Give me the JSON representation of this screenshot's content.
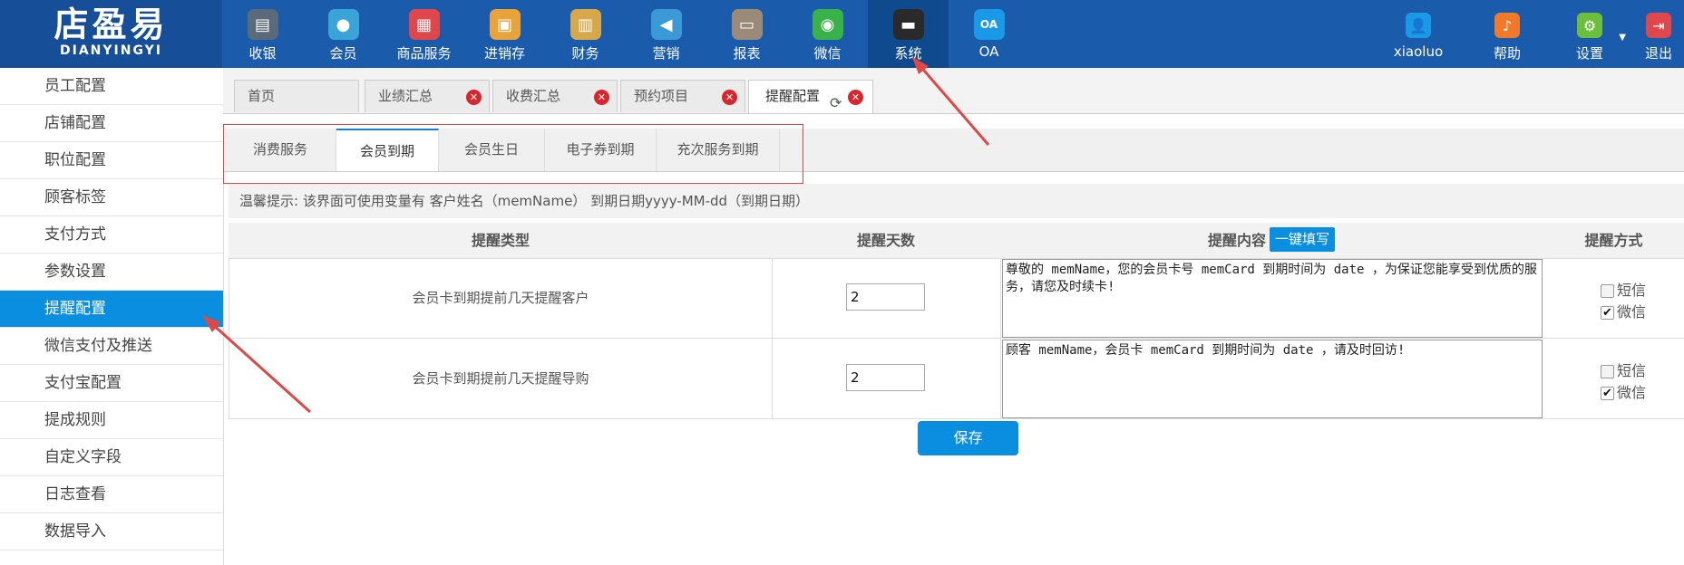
{
  "logo": {
    "cn": "店盈易",
    "en": "DIANYINGYI"
  },
  "nav": [
    {
      "label": "收银",
      "icon": "cashier-icon",
      "color": "#5b6a7a"
    },
    {
      "label": "会员",
      "icon": "member-icon",
      "color": "#3aa3d8"
    },
    {
      "label": "商品服务",
      "icon": "goods-icon",
      "color": "#e0474c"
    },
    {
      "label": "进销存",
      "icon": "inventory-icon",
      "color": "#e8a33a"
    },
    {
      "label": "财务",
      "icon": "finance-icon",
      "color": "#d6a84a"
    },
    {
      "label": "营销",
      "icon": "marketing-icon",
      "color": "#3b9ad6"
    },
    {
      "label": "报表",
      "icon": "report-icon",
      "color": "#9c8a78"
    },
    {
      "label": "微信",
      "icon": "wechat-icon",
      "color": "#3ab24a"
    },
    {
      "label": "系统",
      "icon": "system-icon",
      "color": "#2a2a2a"
    },
    {
      "label": "OA",
      "icon": "oa-icon",
      "color": "#1a9ae6"
    }
  ],
  "right_nav": [
    {
      "label": "xiaoluo",
      "icon": "user-icon",
      "color": "#1a9ae6"
    },
    {
      "label": "帮助",
      "icon": "help-icon",
      "color": "#f07a2a"
    },
    {
      "label": "设置",
      "icon": "settings-icon",
      "color": "#6cbf3a"
    },
    {
      "label": "退出",
      "icon": "logout-icon",
      "color": "#e0474c"
    }
  ],
  "sidebar": [
    "员工配置",
    "店铺配置",
    "职位配置",
    "顾客标签",
    "支付方式",
    "参数设置",
    "提醒配置",
    "微信支付及推送",
    "支付宝配置",
    "提成规则",
    "自定义字段",
    "日志查看",
    "数据导入"
  ],
  "sidebar_active": "提醒配置",
  "page_tabs": [
    {
      "label": "首页"
    },
    {
      "label": "业绩汇总"
    },
    {
      "label": "收费汇总"
    },
    {
      "label": "预约项目"
    },
    {
      "label": "提醒配置"
    }
  ],
  "sub_tabs": [
    "消费服务",
    "会员到期",
    "会员生日",
    "电子券到期",
    "充次服务到期"
  ],
  "hint": "温馨提示: 该界面可使用变量有 客户姓名（memName） 到期日期yyyy-MM-dd（到期日期）",
  "table": {
    "headers": {
      "type": "提醒类型",
      "days": "提醒天数",
      "content": "提醒内容",
      "fill_btn": "一键填写",
      "method": "提醒方式"
    },
    "rows": [
      {
        "type": "会员卡到期提前几天提醒客户",
        "days": "2",
        "content": "尊敬的 memName，您的会员卡号 memCard 到期时间为 date ，为保证您能享受到优质的服务，请您及时续卡!",
        "sms": "短信",
        "wechat": "微信",
        "sms_checked": false,
        "wechat_checked": true
      },
      {
        "type": "会员卡到期提前几天提醒导购",
        "days": "2",
        "content": "顾客  memName，会员卡 memCard 到期时间为 date ，请及时回访!",
        "sms": "短信",
        "wechat": "微信",
        "sms_checked": false,
        "wechat_checked": true
      }
    ]
  },
  "save_label": "保存",
  "colors": {
    "topbar": "#1a5bab",
    "accent": "#0a8ee0",
    "annotation": "#e04848"
  }
}
